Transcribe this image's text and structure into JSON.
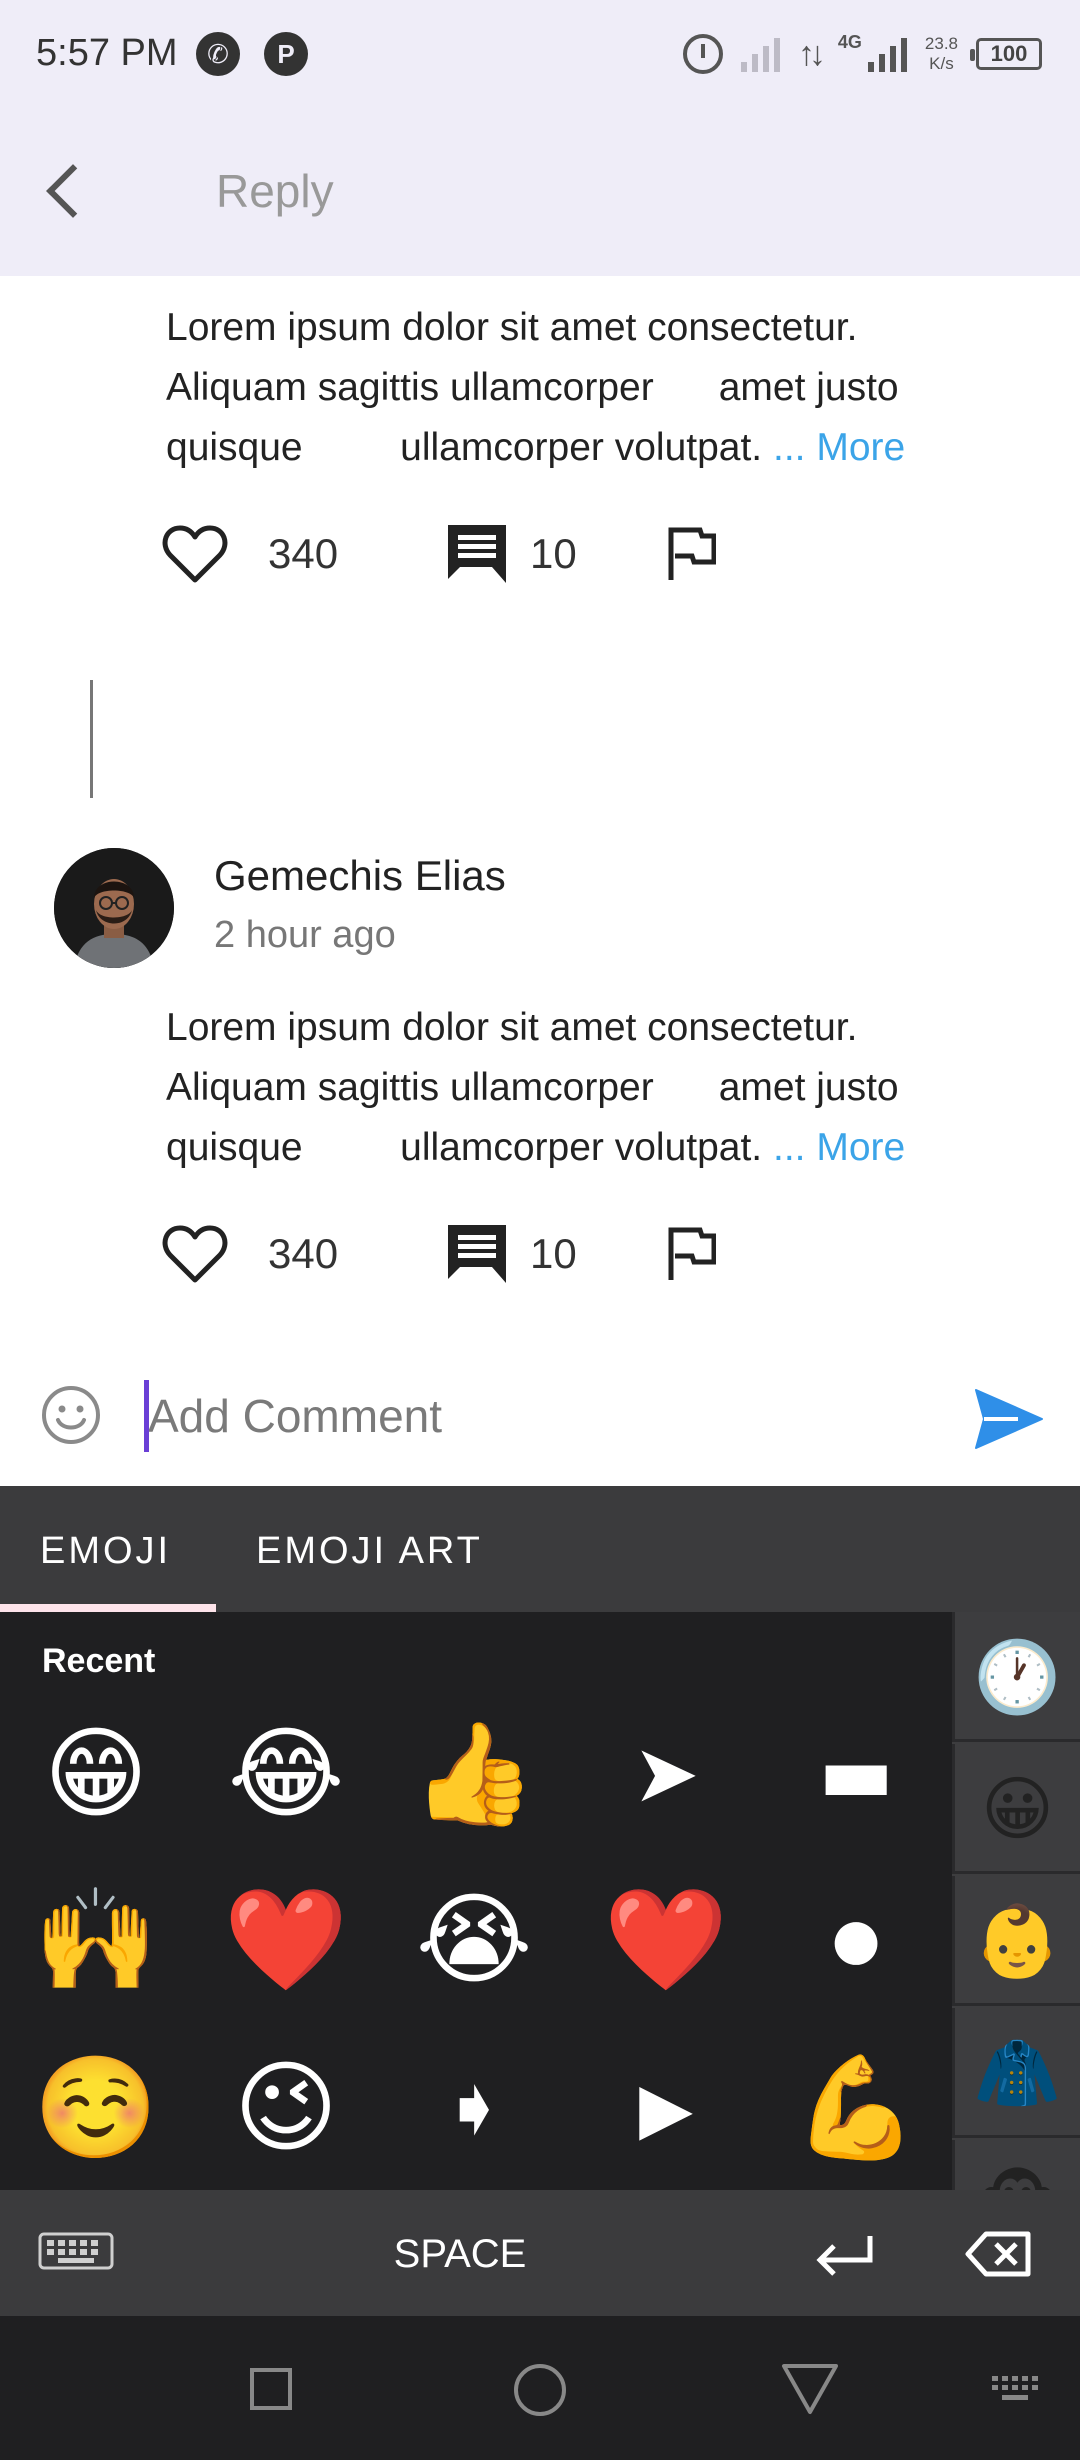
{
  "status_bar": {
    "time": "5:57 PM",
    "call_icon": "phone-icon",
    "app_icon": "P",
    "network_type": "4G",
    "speed_value": "23.8",
    "speed_unit": "K/s",
    "battery": "100"
  },
  "app_bar": {
    "title": "Reply",
    "back_icon": "back-arrow-icon"
  },
  "comments": [
    {
      "text_lines": [
        "Lorem ipsum dolor sit amet consectetur.",
        "Aliquam sagittis ullamcorper      amet justo",
        "quisque         ullamcorper volutpat. "
      ],
      "more_label": "... More",
      "likes": "340",
      "replies": "10"
    },
    {
      "author": "Gemechis Elias",
      "time": "2 hour ago",
      "text_lines": [
        "Lorem ipsum dolor sit amet consectetur.",
        "Aliquam sagittis ullamcorper      amet justo",
        "quisque         ullamcorper volutpat. "
      ],
      "more_label": "... More",
      "likes": "340",
      "replies": "10"
    }
  ],
  "comment_input": {
    "placeholder": "Add Comment",
    "value": ""
  },
  "emoji_keyboard": {
    "tabs": [
      "EMOJI",
      "EMOJI ART"
    ],
    "active_tab": "EMOJI",
    "section_label": "Recent",
    "emojis": [
      "😁",
      "😂",
      "👍",
      "➤",
      "▬",
      "🙌",
      "❤️",
      "😭",
      "❤️",
      "●",
      "☺️",
      "😉",
      "➧",
      "▶",
      "💪"
    ],
    "category_icons": [
      "🕐",
      "😀",
      "👶",
      "🧥",
      "🐵"
    ],
    "space_label": "SPACE"
  },
  "colors": {
    "accent": "#3ba4e8",
    "header_bg": "#efedf8",
    "keyboard_bg": "#3b3b3d",
    "send": "#2f8fe8",
    "cursor": "#6a3fd6"
  }
}
